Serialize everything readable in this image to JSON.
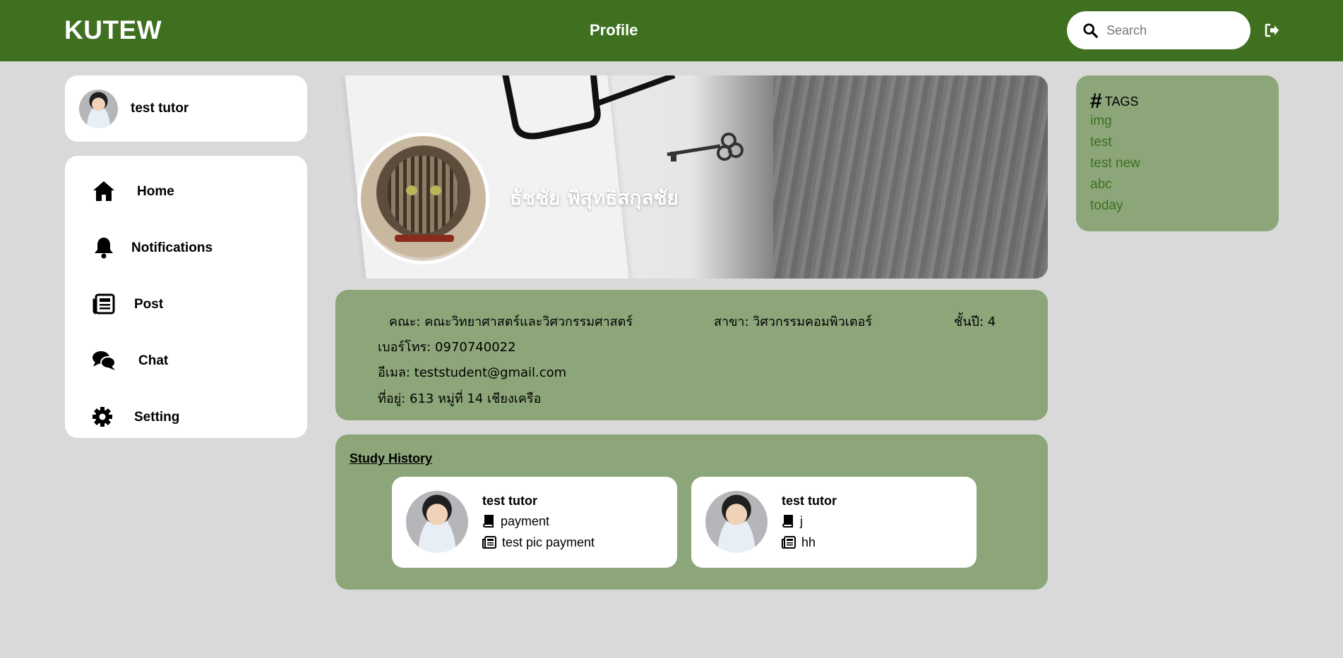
{
  "header": {
    "brand": "KUTEW",
    "page_title": "Profile",
    "search_placeholder": "Search"
  },
  "user": {
    "name": "test tutor"
  },
  "nav": {
    "items": [
      {
        "label": "Home",
        "icon": "home-icon"
      },
      {
        "label": "Notifications",
        "icon": "bell-icon"
      },
      {
        "label": "Post",
        "icon": "newspaper-icon"
      },
      {
        "label": "Chat",
        "icon": "chat-icon"
      },
      {
        "label": "Setting",
        "icon": "gear-icon"
      }
    ]
  },
  "profile": {
    "name": "ธัชชัย พิสุทธิสกุลชัย",
    "faculty": "คณะ: คณะวิทยาศาสตร์และวิศวกรรมศาสตร์",
    "major": "สาขา: วิศวกรรมคอมพิวเตอร์",
    "year": "ชั้นปี: 4",
    "phone": "เบอร์โทร: 0970740022",
    "email": "อีเมล: teststudent@gmail.com",
    "address": "ที่อยู่: 613 หมู่ที่ 14 เชียงเครือ"
  },
  "study_history": {
    "title": "Study History",
    "cards": [
      {
        "tutor": "test tutor",
        "subject": "payment",
        "post": "test pic payment"
      },
      {
        "tutor": "test tutor",
        "subject": "j",
        "post": "hh"
      }
    ]
  },
  "tags": {
    "title": "TAGS",
    "items": [
      "img",
      "test",
      "test new",
      "abc",
      "today"
    ]
  },
  "colors": {
    "header_bg": "#3e7020",
    "page_bg": "#d9d9d9",
    "panel_green": "#8ca67a",
    "tag_text": "#3e7020"
  }
}
